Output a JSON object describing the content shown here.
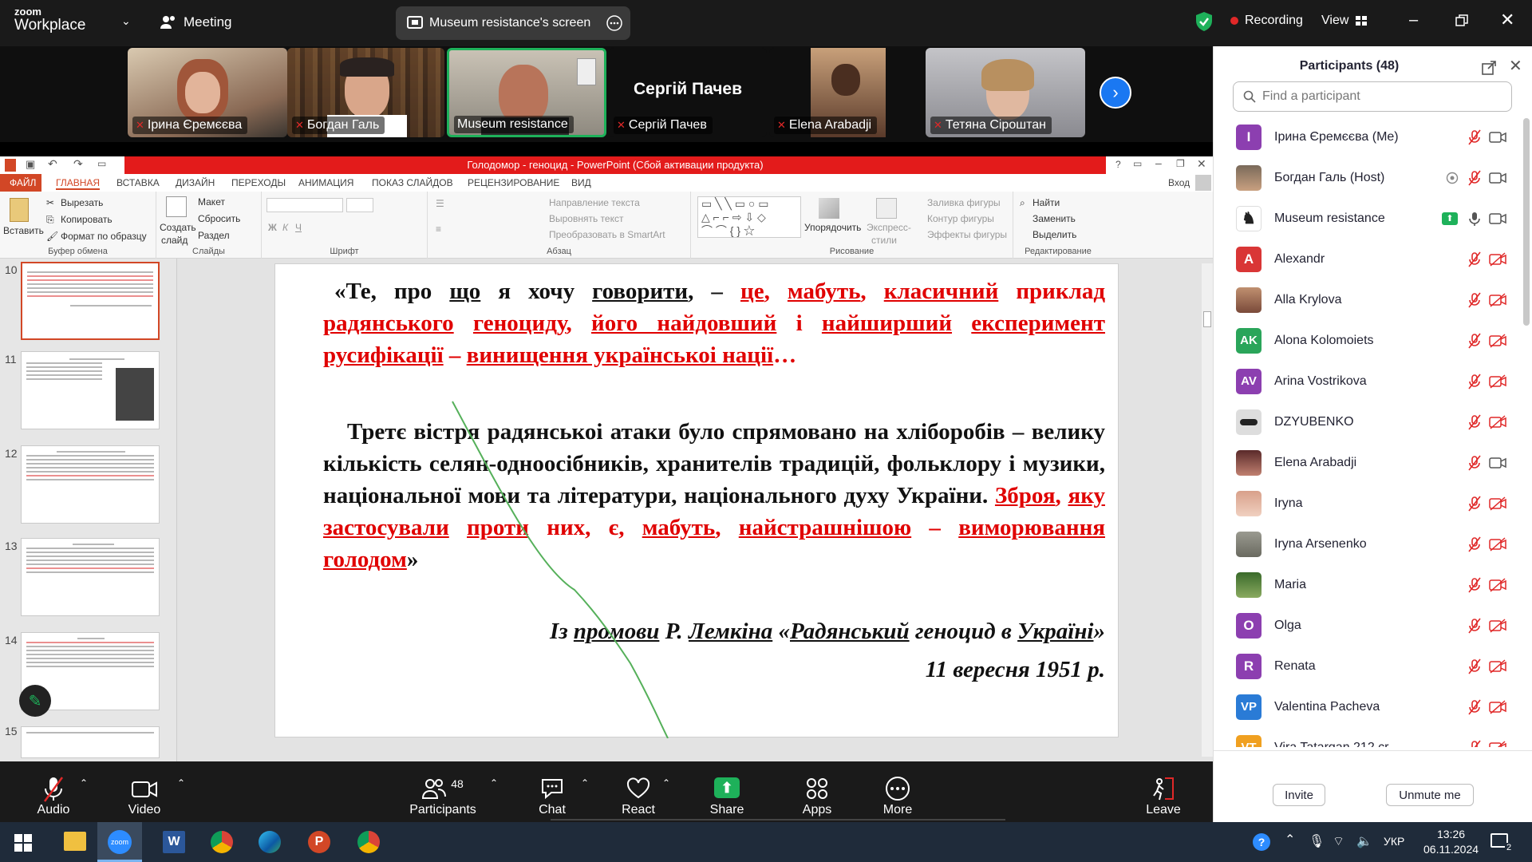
{
  "zoom": {
    "brand_top": "zoom",
    "brand_bottom": "Workplace",
    "meeting_label": "Meeting",
    "share_label": "Museum resistance's screen",
    "recording_label": "Recording",
    "view_label": "View"
  },
  "video_tiles": [
    {
      "name": "Ірина Єремєєва",
      "muted": true
    },
    {
      "name": "Богдан Галь",
      "muted": true
    },
    {
      "name": "Museum resistance",
      "muted": false,
      "active": true
    },
    {
      "name": "Сергій Пачев",
      "muted": true,
      "big_name": "Сергій Пачев"
    },
    {
      "name": "Elena Arabadji",
      "muted": true
    },
    {
      "name": "Тетяна Сіроштан",
      "muted": true
    }
  ],
  "powerpoint": {
    "title": "Голодомор - геноцид - PowerPoint (Сбой активации продукта)",
    "signin": "Вход",
    "tabs": [
      "ФАЙЛ",
      "ГЛАВНАЯ",
      "ВСТАВКА",
      "ДИЗАЙН",
      "ПЕРЕХОДЫ",
      "АНИМАЦИЯ",
      "ПОКАЗ СЛАЙДОВ",
      "РЕЦЕНЗИРОВАНИЕ",
      "ВИД"
    ],
    "ribbon": {
      "paste": "Вставить",
      "cut": "Вырезать",
      "copy": "Копировать",
      "format_painter": "Формат по образцу",
      "clipboard": "Буфер обмена",
      "new_slide_1": "Создать",
      "new_slide_2": "слайд",
      "layout": "Макет",
      "reset": "Сбросить",
      "section": "Раздел",
      "slides": "Слайды",
      "font": "Шрифт",
      "text_direction": "Направление текста",
      "align_text": "Выровнять текст",
      "smartart": "Преобразовать в SmartArt",
      "paragraph": "Абзац",
      "arrange": "Упорядочить",
      "quick_styles_1": "Экспресс-",
      "quick_styles_2": "стили",
      "shape_fill": "Заливка фигуры",
      "shape_outline": "Контур фигуры",
      "shape_effects": "Эффекты фигуры",
      "drawing": "Рисование",
      "find": "Найти",
      "replace": "Заменить",
      "select": "Выделить",
      "editing": "Редактирование"
    },
    "slide_numbers": [
      "10",
      "11",
      "12",
      "13",
      "14",
      "15"
    ],
    "slide": {
      "p1_open": "«Те, про ",
      "p1_shcho": "що",
      "p1_ya": " я хочу ",
      "p1_hovoryty": "говорити",
      "p1_dash": ", – ",
      "p1_red1": "це",
      "p1_red2": ", ",
      "p1_red3": "мабуть",
      "p1_red4": ", ",
      "p1_red5": "класичний",
      "p1_red6": " приклад ",
      "p1_red7": "радянського",
      "p1_red8": " ",
      "p1_red9": "геноциду",
      "p1_red10": ", ",
      "p1_red11": "його найдовший",
      "p1_red12": " і ",
      "p1_red13": "найширший",
      "p1_red14": " ",
      "p1_red15": "експеримент",
      "p1_red16": " ",
      "p1_red17": "русифікації",
      "p1_red18": " – ",
      "p1_red19": "винищення українськоі нації",
      "p1_red20": "…",
      "p2_black": "Третє вістря радянськоі атаки було спрямовано на хліборобів – велику кількість селян-одноосібників, хранителів традицій, фольклору і музики, національної мови та літератури, національного духу України. ",
      "p2_red1": "Зброя",
      "p2_red2": ", ",
      "p2_red3": "яку",
      "p2_red4": " ",
      "p2_red5": "застосували",
      "p2_red6": " ",
      "p2_red7": "проти",
      "p2_red8": " них, є, ",
      "p2_red9": "мабуть",
      "p2_red10": ", ",
      "p2_red11": "найстрашнішою",
      "p2_red12": " – ",
      "p2_red13": "виморювання",
      "p2_red14": " ",
      "p2_red15": "голодом",
      "p2_close": "»",
      "src_1": "Із ",
      "src_2": "промови",
      "src_3": " Р. ",
      "src_4": "Лемкіна",
      "src_5": " «",
      "src_6": "Радянський",
      "src_7": " геноцид в ",
      "src_8": "Україні",
      "src_9": "»",
      "date": "11 вересня 1951 р."
    }
  },
  "toolbar": {
    "audio": "Audio",
    "video": "Video",
    "participants": "Participants",
    "participants_count": "48",
    "chat": "Chat",
    "react": "React",
    "share": "Share",
    "apps": "Apps",
    "more": "More",
    "leave": "Leave"
  },
  "panel": {
    "title": "Participants (48)",
    "search_placeholder": "Find a participant",
    "invite": "Invite",
    "unmute_me": "Unmute me",
    "participants": [
      {
        "name": "Ірина Єремєєва (Me)",
        "initial": "І",
        "color": "#8c3fb0",
        "video_off": false
      },
      {
        "name": "Богдан Галь (Host)",
        "initial": "",
        "color": "#6a7f8f",
        "video_off": false
      },
      {
        "name": "Museum resistance",
        "initial": "",
        "color": "#ffffff",
        "video_off": false,
        "sharing": true
      },
      {
        "name": "Alexandr",
        "initial": "A",
        "color": "#d93636",
        "video_off": true
      },
      {
        "name": "Alla Krylova",
        "initial": "",
        "color": "#a0725a",
        "video_off": true
      },
      {
        "name": "Alona Kolomoiets",
        "initial": "AK",
        "color": "#2aa55a",
        "video_off": true
      },
      {
        "name": "Arina Vostrikova",
        "initial": "AV",
        "color": "#8c3fb0",
        "video_off": true
      },
      {
        "name": "DZYUBENKO",
        "initial": "",
        "color": "#333333",
        "video_off": true
      },
      {
        "name": "Elena Arabadji",
        "initial": "",
        "color": "#7a3a3a",
        "video_off": false
      },
      {
        "name": "Iryna",
        "initial": "",
        "color": "#c8907a",
        "video_off": true
      },
      {
        "name": "Iryna Arsenenko",
        "initial": "",
        "color": "#8a8f80",
        "video_off": true
      },
      {
        "name": "Maria",
        "initial": "",
        "color": "#4d7a3a",
        "video_off": true
      },
      {
        "name": "Olga",
        "initial": "O",
        "color": "#8c3fb0",
        "video_off": true
      },
      {
        "name": "Renata",
        "initial": "R",
        "color": "#8c3fb0",
        "video_off": true
      },
      {
        "name": "Valentina Pacheva",
        "initial": "VP",
        "color": "#2a7bd6",
        "video_off": true
      },
      {
        "name": "Vira Tatargan 212 cr",
        "initial": "VT",
        "color": "#f0a020",
        "video_off": true
      }
    ]
  },
  "taskbar": {
    "lang": "УКР",
    "time": "13:26",
    "date": "06.11.2024",
    "notif_count": "2"
  }
}
